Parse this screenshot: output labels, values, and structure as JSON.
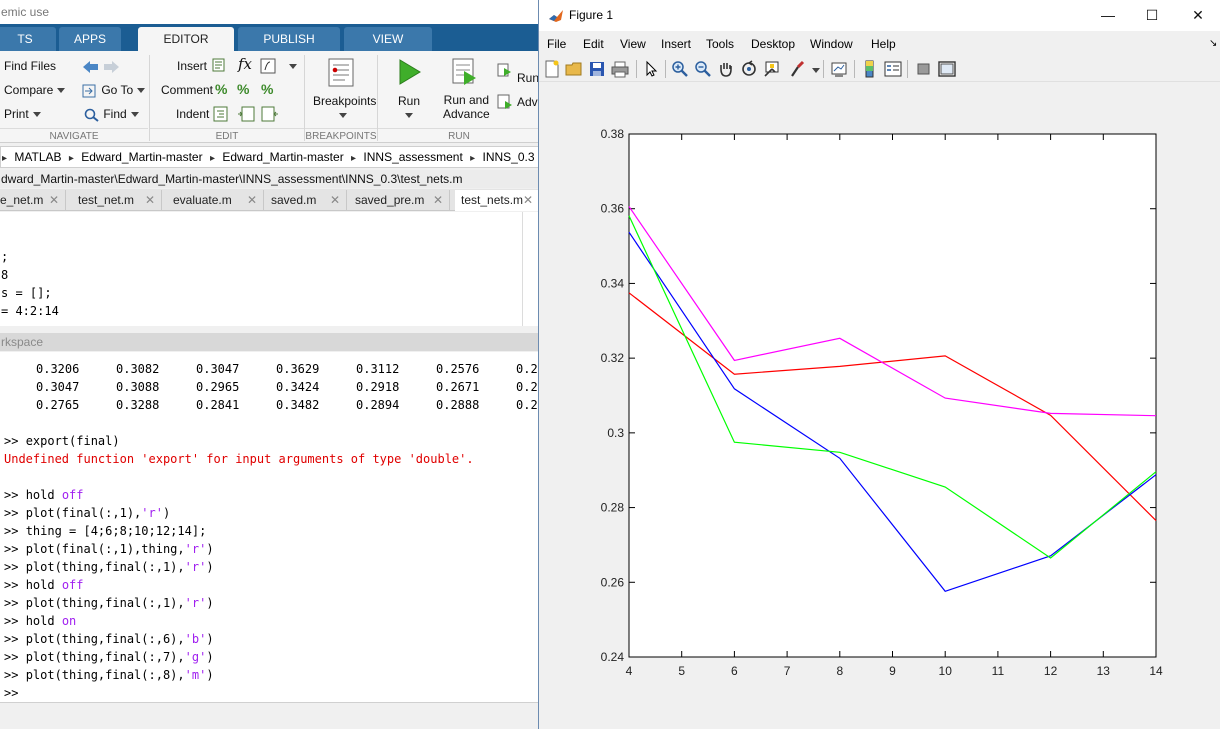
{
  "main": {
    "title_fragment": "emic use",
    "tabs": [
      {
        "label": "TS"
      },
      {
        "label": "APPS"
      },
      {
        "label": "EDITOR"
      },
      {
        "label": "PUBLISH"
      },
      {
        "label": "VIEW"
      }
    ],
    "ribbon": {
      "navigate": {
        "find_files": "Find Files",
        "compare": "Compare",
        "print": "Print",
        "go_to": "Go To",
        "find": "Find",
        "section": "NAVIGATE"
      },
      "edit": {
        "insert": "Insert",
        "comment": "Comment",
        "indent": "Indent",
        "fx": "fx",
        "section": "EDIT"
      },
      "breakpoints": {
        "label": "Breakpoints",
        "section": "BREAKPOINTS"
      },
      "run": {
        "run": "Run",
        "run_and_advance_1": "Run and",
        "run_and_advance_2": "Advance",
        "run_section": "Run",
        "advance": "Adv",
        "section": "RUN"
      }
    },
    "breadcrumb": [
      "MATLAB",
      "Edward_Martin-master",
      "Edward_Martin-master",
      "INNS_assessment",
      "INNS_0.3"
    ],
    "editor_path": "dward_Martin-master\\Edward_Martin-master\\INNS_assessment\\INNS_0.3\\test_nets.m",
    "file_tabs": [
      {
        "label": "e_net.m"
      },
      {
        "label": "test_net.m"
      },
      {
        "label": "evaluate.m"
      },
      {
        "label": "saved.m"
      },
      {
        "label": "saved_pre.m"
      },
      {
        "label": "test_nets.m"
      }
    ],
    "editor_lines": [
      ";",
      "8",
      "s = [];",
      "= 4:2:14"
    ],
    "command_window_title": "rkspace",
    "matrix_rows": [
      [
        "0.3206",
        "0.3082",
        "0.3047",
        "0.3629",
        "0.3112",
        "0.2576",
        "0.2"
      ],
      [
        "0.3047",
        "0.3088",
        "0.2965",
        "0.3424",
        "0.2918",
        "0.2671",
        "0.2"
      ],
      [
        "0.2765",
        "0.3288",
        "0.2841",
        "0.3482",
        "0.2894",
        "0.2888",
        "0.2"
      ]
    ],
    "prompt": ">>",
    "commands": {
      "c1": "export(final)",
      "err": "Undefined function 'export' for input arguments of type 'double'.",
      "c2a": "hold ",
      "c2b": "off",
      "c3a": "plot(final(:,1),",
      "c3b": "'r'",
      "c3c": ")",
      "c4": "thing = [4;6;8;10;12;14];",
      "c5a": "plot(final(:,1),thing,",
      "c5b": "'r'",
      "c5c": ")",
      "c6a": "plot(thing,final(:,1),",
      "c6b": "'r'",
      "c6c": ")",
      "c7a": "hold ",
      "c7b": "off",
      "c8a": "plot(thing,final(:,1),",
      "c8b": "'r'",
      "c8c": ")",
      "c9a": "hold ",
      "c9b": "on",
      "c10a": "plot(thing,final(:,6),",
      "c10b": "'b'",
      "c10c": ")",
      "c11a": "plot(thing,final(:,7),",
      "c11b": "'g'",
      "c11c": ")",
      "c12a": "plot(thing,final(:,8),",
      "c12b": "'m'",
      "c12c": ")"
    }
  },
  "figure": {
    "title": "Figure 1",
    "menu": [
      "File",
      "Edit",
      "View",
      "Insert",
      "Tools",
      "Desktop",
      "Window",
      "Help"
    ],
    "chart_data": {
      "type": "line",
      "title": "",
      "xlabel": "",
      "ylabel": "",
      "xlim": [
        4,
        14
      ],
      "ylim": [
        0.24,
        0.38
      ],
      "xticks": [
        4,
        5,
        6,
        7,
        8,
        9,
        10,
        11,
        12,
        13,
        14
      ],
      "yticks": [
        0.24,
        0.26,
        0.28,
        0.3,
        0.32,
        0.34,
        0.36,
        0.38
      ],
      "ytick_labels": [
        "0.24",
        "0.26",
        "0.28",
        "0.3",
        "0.32",
        "0.34",
        "0.36",
        "0.38"
      ],
      "grid": false,
      "x": [
        4,
        6,
        8,
        10,
        12,
        14
      ],
      "series": [
        {
          "color": "#ff0000",
          "values": [
            0.3375,
            0.3157,
            0.3178,
            0.3206,
            0.3047,
            0.2765
          ]
        },
        {
          "color": "#0000ff",
          "values": [
            0.3537,
            0.3118,
            0.2932,
            0.2576,
            0.2671,
            0.2888
          ]
        },
        {
          "color": "#00ff00",
          "values": [
            0.3581,
            0.2975,
            0.2948,
            0.2855,
            0.2665,
            0.2896
          ]
        },
        {
          "color": "#ff00ff",
          "values": [
            0.3606,
            0.3194,
            0.3253,
            0.3093,
            0.3052,
            0.3046
          ]
        }
      ]
    }
  }
}
